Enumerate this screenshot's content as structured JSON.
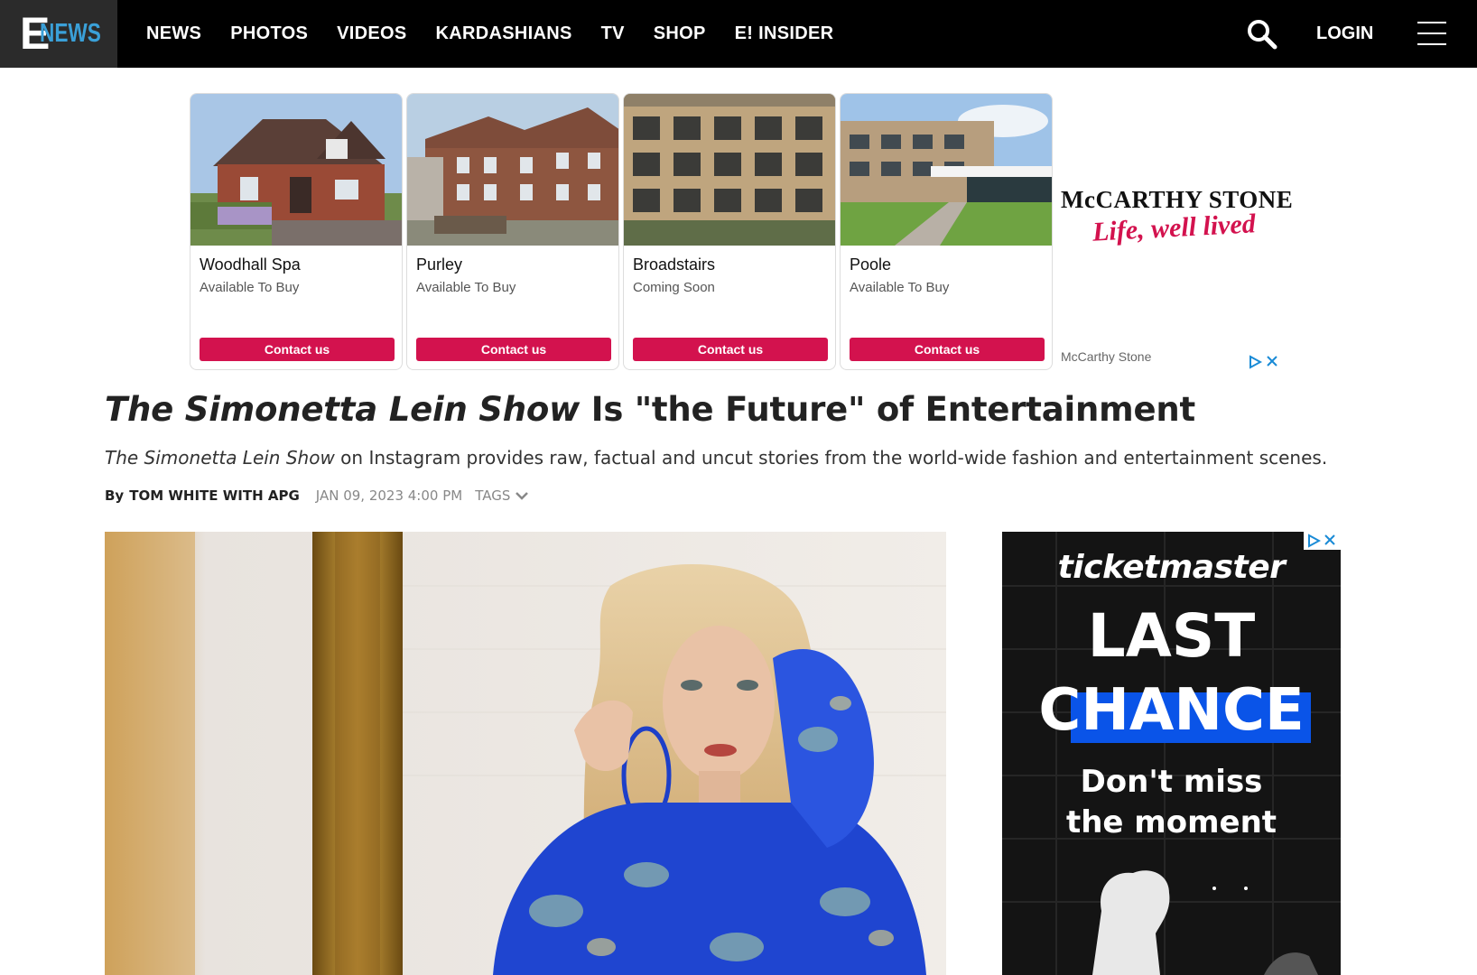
{
  "site": {
    "logo_e": "E",
    "logo_news": "NEWS"
  },
  "nav": {
    "items": [
      "NEWS",
      "PHOTOS",
      "VIDEOS",
      "KARDASHIANS",
      "TV",
      "SHOP",
      "E! INSIDER"
    ],
    "login": "LOGIN",
    "search_icon": "search-icon",
    "menu_icon": "hamburger-menu-icon"
  },
  "top_ad": {
    "brand": "McCARTHY STONE",
    "tagline": "Life, well lived",
    "advertiser": "McCarthy Stone",
    "cards": [
      {
        "title": "Woodhall Spa",
        "status": "Available To Buy",
        "button": "Contact us"
      },
      {
        "title": "Purley",
        "status": "Available To Buy",
        "button": "Contact us"
      },
      {
        "title": "Broadstairs",
        "status": "Coming Soon",
        "button": "Contact us"
      },
      {
        "title": "Poole",
        "status": "Available To Buy",
        "button": "Contact us"
      }
    ],
    "accent_color": "#d3124e"
  },
  "article": {
    "headline_show": "The Simonetta Lein Show",
    "headline_rest": " Is \"the Future\" of Entertainment",
    "subhead_show": "The Simonetta Lein Show",
    "subhead_rest": " on Instagram provides raw, factual and uncut stories from the world-wide fashion and entertainment scenes.",
    "by_prefix": "By",
    "author": "TOM WHITE WITH APG",
    "date": "JAN 09, 2023 4:00 PM",
    "tags_label": "TAGS"
  },
  "side_ad": {
    "logo": "ticketmaster",
    "line1": "LAST",
    "line2": "CHANCE",
    "line3": "Don't miss",
    "line4": "the moment",
    "highlight_color": "#0a54e8"
  }
}
